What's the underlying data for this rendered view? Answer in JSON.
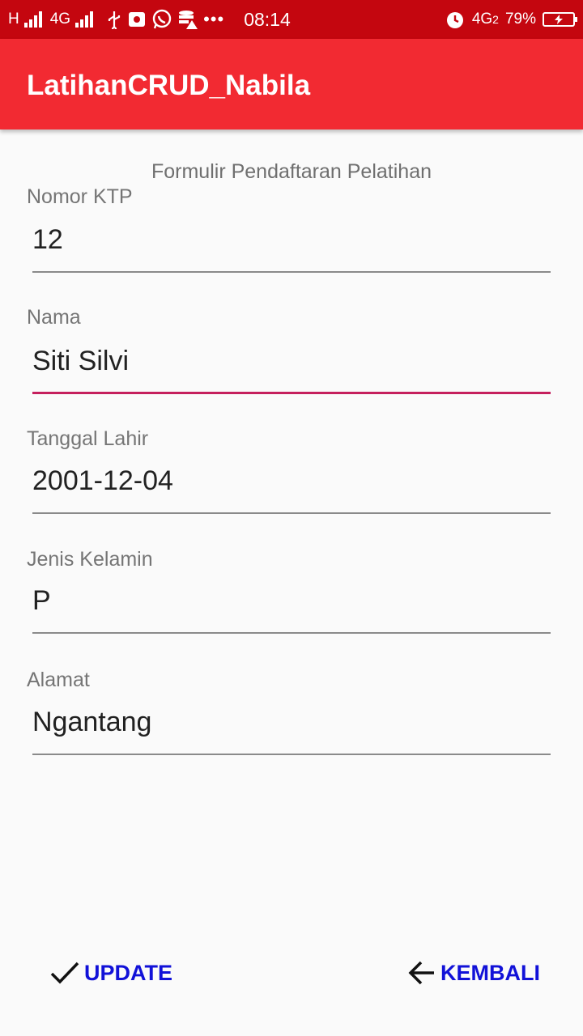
{
  "status_bar": {
    "network_left": "H",
    "network_type": "4G",
    "time": "08:14",
    "network_right": "4G",
    "network_right_sub": "2",
    "battery_percent": "79%",
    "icons": [
      "signal-icon",
      "usb-icon",
      "whatsapp-icon",
      "storage-warning-icon",
      "more-dots-icon",
      "alarm-icon",
      "battery-charging-icon"
    ]
  },
  "app_bar": {
    "title": "LatihanCRUD_Nabila",
    "color": "#f22a32"
  },
  "form": {
    "title": "Formulir Pendaftaran Pelatihan",
    "fields": [
      {
        "label": "Nomor KTP",
        "value": "12"
      },
      {
        "label": "Nama",
        "value": "Siti Silvi",
        "focused": true
      },
      {
        "label": "Tanggal Lahir",
        "value": "2001-12-04"
      },
      {
        "label": "Jenis Kelamin",
        "value": "P"
      },
      {
        "label": "Alamat",
        "value": "Ngantang"
      }
    ]
  },
  "actions": {
    "update_label": "UPDATE",
    "update_icon": "check-icon",
    "back_label": "KEMBALI",
    "back_icon": "arrow-left-icon",
    "color": "#1111d8"
  }
}
